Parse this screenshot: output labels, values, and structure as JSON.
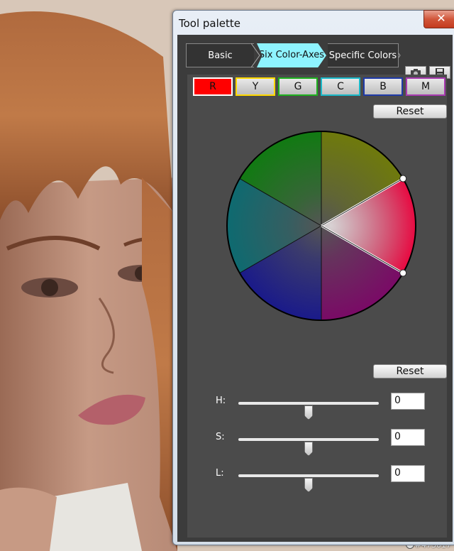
{
  "window": {
    "title": "Tool palette",
    "close_label": "✕"
  },
  "tabs": [
    {
      "label": "Basic",
      "active": false
    },
    {
      "label": "Six Color-Axes",
      "active": true
    },
    {
      "label": "Specific Colors",
      "active": false
    }
  ],
  "toolbar": {
    "icons": [
      "camera-icon",
      "save-icon"
    ]
  },
  "channels": [
    {
      "label": "R",
      "color": "#ff0000",
      "border": "#ffffff",
      "active": true
    },
    {
      "label": "Y",
      "color": "#ffd800",
      "border": "#ffd800",
      "active": false
    },
    {
      "label": "G",
      "color": "#1fb01f",
      "border": "#1fb01f",
      "active": false
    },
    {
      "label": "C",
      "color": "#1ab8c8",
      "border": "#1ab8c8",
      "active": false
    },
    {
      "label": "B",
      "color": "#1f3aa8",
      "border": "#1f3aa8",
      "active": false
    },
    {
      "label": "M",
      "color": "#a83ab0",
      "border": "#a83ab0",
      "active": false
    }
  ],
  "reset_top_label": "Reset",
  "reset_bottom_label": "Reset",
  "sliders": [
    {
      "label": "H:",
      "value": "0",
      "level": 0.5
    },
    {
      "label": "S:",
      "value": "0",
      "level": 0.5
    },
    {
      "label": "L:",
      "value": "0",
      "level": 0.5
    }
  ],
  "watermark": "#473017"
}
